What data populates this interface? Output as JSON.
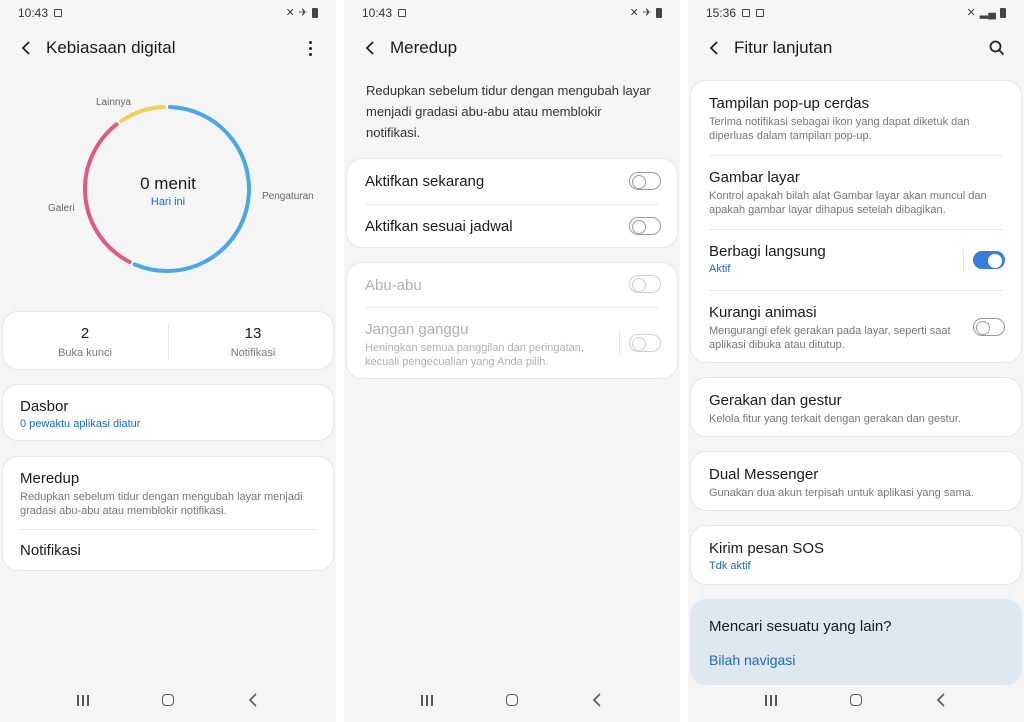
{
  "screen1": {
    "status": {
      "time": "10:43"
    },
    "title": "Kebiasaan digital",
    "donut": {
      "segments": [
        {
          "label": "Pengaturan",
          "color": "#4aa8e8",
          "fraction": 0.57
        },
        {
          "label": "Galeri",
          "color": "#e05a7a",
          "fraction": 0.33
        },
        {
          "label": "Lainnya",
          "color": "#f2cf5b",
          "fraction": 0.1
        }
      ],
      "center_value": "0 menit",
      "center_sub": "Hari ini"
    },
    "stats": [
      {
        "value": "2",
        "label": "Buka kunci"
      },
      {
        "value": "13",
        "label": "Notifikasi"
      }
    ],
    "dasbor": {
      "title": "Dasbor",
      "link": "0 pewaktu aplikasi diatur"
    },
    "meredup": {
      "title": "Meredup",
      "desc": "Redupkan sebelum tidur dengan mengubah layar menjadi gradasi abu-abu atau memblokir notifikasi."
    },
    "notifikasi": {
      "title": "Notifikasi"
    }
  },
  "screen2": {
    "status": {
      "time": "10:43"
    },
    "title": "Meredup",
    "intro": "Redupkan sebelum tidur dengan mengubah layar menjadi gradasi abu-abu atau memblokir notifikasi.",
    "options": [
      {
        "label": "Aktifkan sekarang",
        "on": false
      },
      {
        "label": "Aktifkan sesuai jadwal",
        "on": false
      }
    ],
    "disabled_options": [
      {
        "label": "Abu-abu",
        "on": false
      },
      {
        "label": "Jangan ganggu",
        "desc": "Heningkan semua panggilan dan peringatan, kecuali pengecualian yang Anda pilih.",
        "on": false
      }
    ]
  },
  "screen3": {
    "status": {
      "time": "15:36"
    },
    "title": "Fitur lanjutan",
    "group1": [
      {
        "title": "Tampilan pop-up cerdas",
        "desc": "Terima notifikasi sebagai ikon yang dapat diketuk dan diperluas dalam tampilan pop-up."
      },
      {
        "title": "Gambar layar",
        "desc": "Kontrol apakah bilah alat Gambar layar akan muncul dan apakah gambar layar dihapus setelah dibagikan."
      },
      {
        "title": "Berbagi langsung",
        "status": "Aktif",
        "on": true
      },
      {
        "title": "Kurangi animasi",
        "desc": "Mengurangi efek gerakan pada layar, seperti saat aplikasi dibuka atau ditutup.",
        "on": false
      }
    ],
    "gerakan": {
      "title": "Gerakan dan gestur",
      "desc": "Kelola fitur yang terkait dengan gerakan dan gestur."
    },
    "dual": {
      "title": "Dual Messenger",
      "desc": "Gunakan dua akun terpisah untuk aplikasi yang sama."
    },
    "sos": {
      "title": "Kirim pesan SOS",
      "status": "Tdk aktif"
    },
    "find": {
      "title": "Mencari sesuatu yang lain?",
      "link": "Bilah navigasi"
    }
  }
}
